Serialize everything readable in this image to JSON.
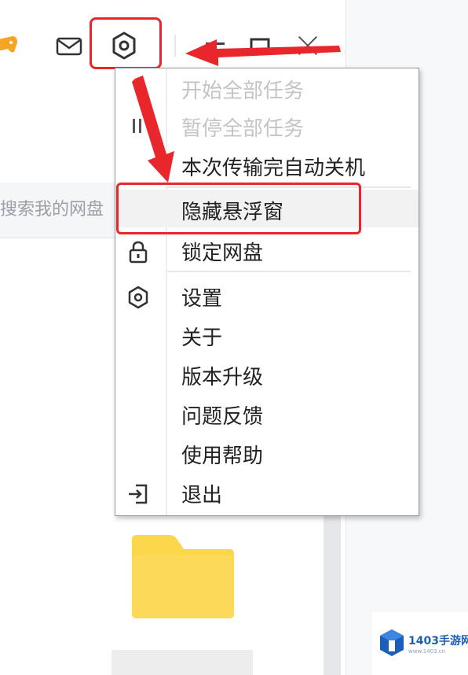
{
  "header": {
    "search_placeholder_partial": "搜索我的网盘"
  },
  "context_menu": {
    "items": [
      {
        "label": "开始全部任务",
        "enabled": false,
        "icon": "play-icon"
      },
      {
        "label": "暂停全部任务",
        "enabled": false,
        "icon": "pause-icon"
      },
      {
        "label": "本次传输完自动关机",
        "enabled": true,
        "icon": ""
      },
      {
        "label": "隐藏悬浮窗",
        "enabled": true,
        "icon": "",
        "highlighted": true
      },
      {
        "label": "锁定网盘",
        "enabled": true,
        "icon": "lock-icon"
      },
      {
        "label": "设置",
        "enabled": true,
        "icon": "gear-icon"
      },
      {
        "label": "关于",
        "enabled": true,
        "icon": ""
      },
      {
        "label": "版本升级",
        "enabled": true,
        "icon": ""
      },
      {
        "label": "问题反馈",
        "enabled": true,
        "icon": ""
      },
      {
        "label": "使用帮助",
        "enabled": true,
        "icon": ""
      },
      {
        "label": "退出",
        "enabled": true,
        "icon": "exit-icon"
      }
    ]
  },
  "annotation_color": "#e8262b",
  "folder_color": "#fcd64b",
  "watermark": {
    "brand": "1403手游网",
    "sub": "www.1403.cn"
  }
}
